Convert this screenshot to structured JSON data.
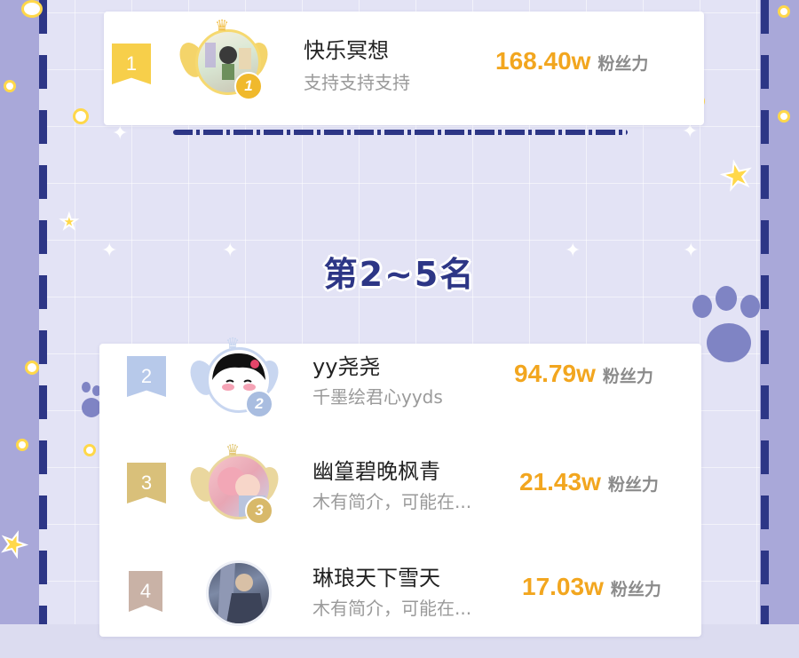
{
  "section": {
    "title": "第2~5名"
  },
  "colors": {
    "accent_navy": "#2d3686",
    "fans_orange": "#f2a61f",
    "gold": "#f2c14e",
    "silver": "#9eb7df",
    "bronze": "#d8b96a",
    "rank4": "#c9b2a6"
  },
  "fans_unit": "粉丝力",
  "leaders": [
    {
      "rank": "1",
      "name": "快乐冥想",
      "bio": "支持支持支持",
      "fans": "168.40w",
      "medal": "1",
      "avatar_icon": "manga-character-avatar"
    },
    {
      "rank": "2",
      "name": "yy尧尧",
      "bio": "千墨绘君心yyds",
      "fans": "94.79w",
      "medal": "2",
      "avatar_icon": "blushing-girl-avatar"
    },
    {
      "rank": "3",
      "name": "幽篁碧晚枫青",
      "bio": "木有简介，可能在...",
      "fans": "21.43w",
      "medal": "3",
      "avatar_icon": "pink-hair-couple-avatar"
    },
    {
      "rank": "4",
      "name": "琳琅天下雪天",
      "bio": "木有简介，可能在...",
      "fans": "17.03w",
      "avatar_icon": "dark-character-avatar"
    }
  ]
}
